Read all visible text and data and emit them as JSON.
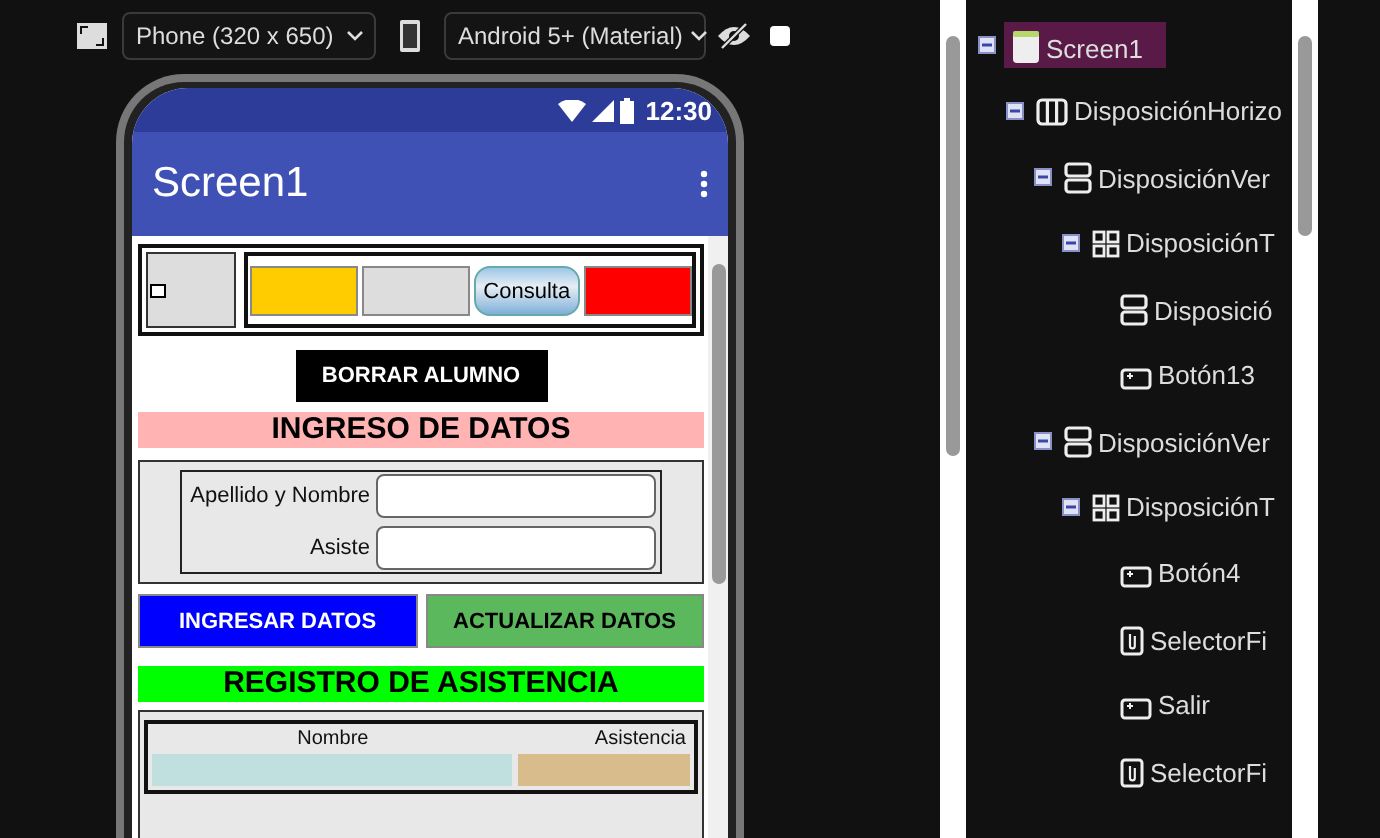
{
  "toolbar": {
    "device_select": "Phone (320 x 650)",
    "theme_select": "Android 5+ (Material)",
    "show_hidden": {
      "checked": false
    }
  },
  "phone": {
    "status_time": "12:30",
    "app_title": "Screen1",
    "top_row": {
      "checkbox": {
        "checked": false
      },
      "swatches": [
        {
          "kind": "color",
          "color": "#ffcc00"
        },
        {
          "kind": "color",
          "color": "#dddddd"
        },
        {
          "kind": "image",
          "label": "Consulta"
        },
        {
          "kind": "color",
          "color": "#ff0000"
        }
      ]
    },
    "delete_button": "BORRAR ALUMNO",
    "input_heading": "INGRESO DE DATOS",
    "fields": [
      {
        "label": "Apellido y Nombre"
      },
      {
        "label": "Asiste"
      }
    ],
    "buttons": [
      {
        "label": "INGRESAR DATOS",
        "color": "#0000ff"
      },
      {
        "label": "ACTUALIZAR DATOS",
        "color": "#5cb85c"
      }
    ],
    "attendance_heading": "REGISTRO DE ASISTENCIA",
    "table": {
      "columns": [
        {
          "label": "Nombre",
          "color": "#c0e0e0"
        },
        {
          "label": "Asistencia",
          "color": "#d8bc8c"
        }
      ]
    }
  },
  "tree": [
    {
      "label": "Screen1",
      "kind": "screen",
      "selected": true,
      "expanded": true,
      "children": [
        {
          "label": "DisposiciónHorizo",
          "kind": "horizontal",
          "selected": false,
          "expanded": true,
          "children": [
            {
              "label": "DisposiciónVer",
              "kind": "vertical",
              "selected": false,
              "expanded": true,
              "children": [
                {
                  "label": "DisposiciónT",
                  "kind": "table",
                  "selected": false,
                  "expanded": true,
                  "children": [
                    {
                      "label": "Disposició",
                      "kind": "vertical",
                      "selected": false
                    },
                    {
                      "label": "Botón13",
                      "kind": "button",
                      "selected": false
                    }
                  ]
                }
              ]
            },
            {
              "label": "DisposiciónVer",
              "kind": "vertical",
              "selected": false,
              "expanded": true,
              "children": [
                {
                  "label": "DisposiciónT",
                  "kind": "table",
                  "selected": false,
                  "expanded": true,
                  "children": [
                    {
                      "label": "Botón4",
                      "kind": "button",
                      "selected": false
                    },
                    {
                      "label": "SelectorFi",
                      "kind": "picker",
                      "selected": false
                    },
                    {
                      "label": "Salir",
                      "kind": "button",
                      "selected": false
                    },
                    {
                      "label": "SelectorFi",
                      "kind": "picker",
                      "selected": false
                    }
                  ]
                }
              ]
            }
          ]
        }
      ]
    }
  ]
}
